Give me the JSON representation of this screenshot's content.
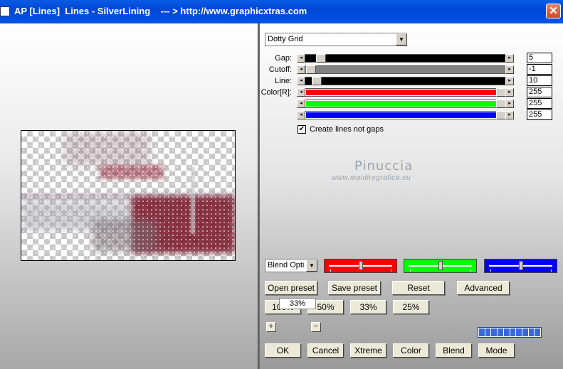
{
  "window": {
    "title": "AP [Lines]  Lines - SilverLining    --- > http://www.graphicxtras.com",
    "close_symbol": "✕"
  },
  "preset_dropdown": {
    "selected": "Dotty Grid"
  },
  "sliders": [
    {
      "id": "gap",
      "label": "Gap:",
      "value": "5",
      "fill_color": "#000000",
      "thumb_fraction": 0.05
    },
    {
      "id": "cutoff",
      "label": "Cutoff:",
      "value": "-1",
      "fill_color": "#808080",
      "thumb_fraction": 0.0
    },
    {
      "id": "line",
      "label": "Line:",
      "value": "10",
      "fill_color": "#000000",
      "thumb_fraction": 0.03
    },
    {
      "id": "red",
      "label": "Color[R]:",
      "value": "255",
      "fill_color": "#ff0000",
      "thumb_fraction": 1.0
    },
    {
      "id": "green",
      "label": "",
      "value": "255",
      "fill_color": "#00ff00",
      "thumb_fraction": 1.0
    },
    {
      "id": "blue",
      "label": "",
      "value": "255",
      "fill_color": "#0000ff",
      "thumb_fraction": 1.0
    }
  ],
  "checkbox": {
    "label": "Create lines not gaps",
    "checked": true,
    "check_symbol": "✔"
  },
  "watermark": {
    "name": "Pinuccia",
    "url": "www.maidiregrafica.eu"
  },
  "blend_dropdown": {
    "selected": "Blend Options"
  },
  "color_boxes": [
    {
      "id": "red",
      "color": "#ff0000",
      "knob_fraction": 0.5
    },
    {
      "id": "green",
      "color": "#00ff00",
      "knob_fraction": 0.5
    },
    {
      "id": "blue",
      "color": "#0000ff",
      "knob_fraction": 0.5
    }
  ],
  "buttons": {
    "open_preset": "Open preset",
    "save_preset": "Save preset",
    "reset": "Reset",
    "advanced": "Advanced",
    "zoom_100": "100%",
    "zoom_50": "50%",
    "zoom_33": "33%",
    "zoom_25": "25%",
    "ok": "OK",
    "cancel": "Cancel",
    "xtreme": "Xtreme",
    "color": "Color",
    "blend": "Blend",
    "mode": "Mode"
  },
  "zoom": {
    "plus": "+",
    "minus": "−",
    "value": "33%"
  },
  "progress": {
    "cells": 10,
    "filled": 10
  },
  "icons": {
    "dropdown_arrow": "▼",
    "left_arrow": "◂",
    "right_arrow": "▸"
  }
}
